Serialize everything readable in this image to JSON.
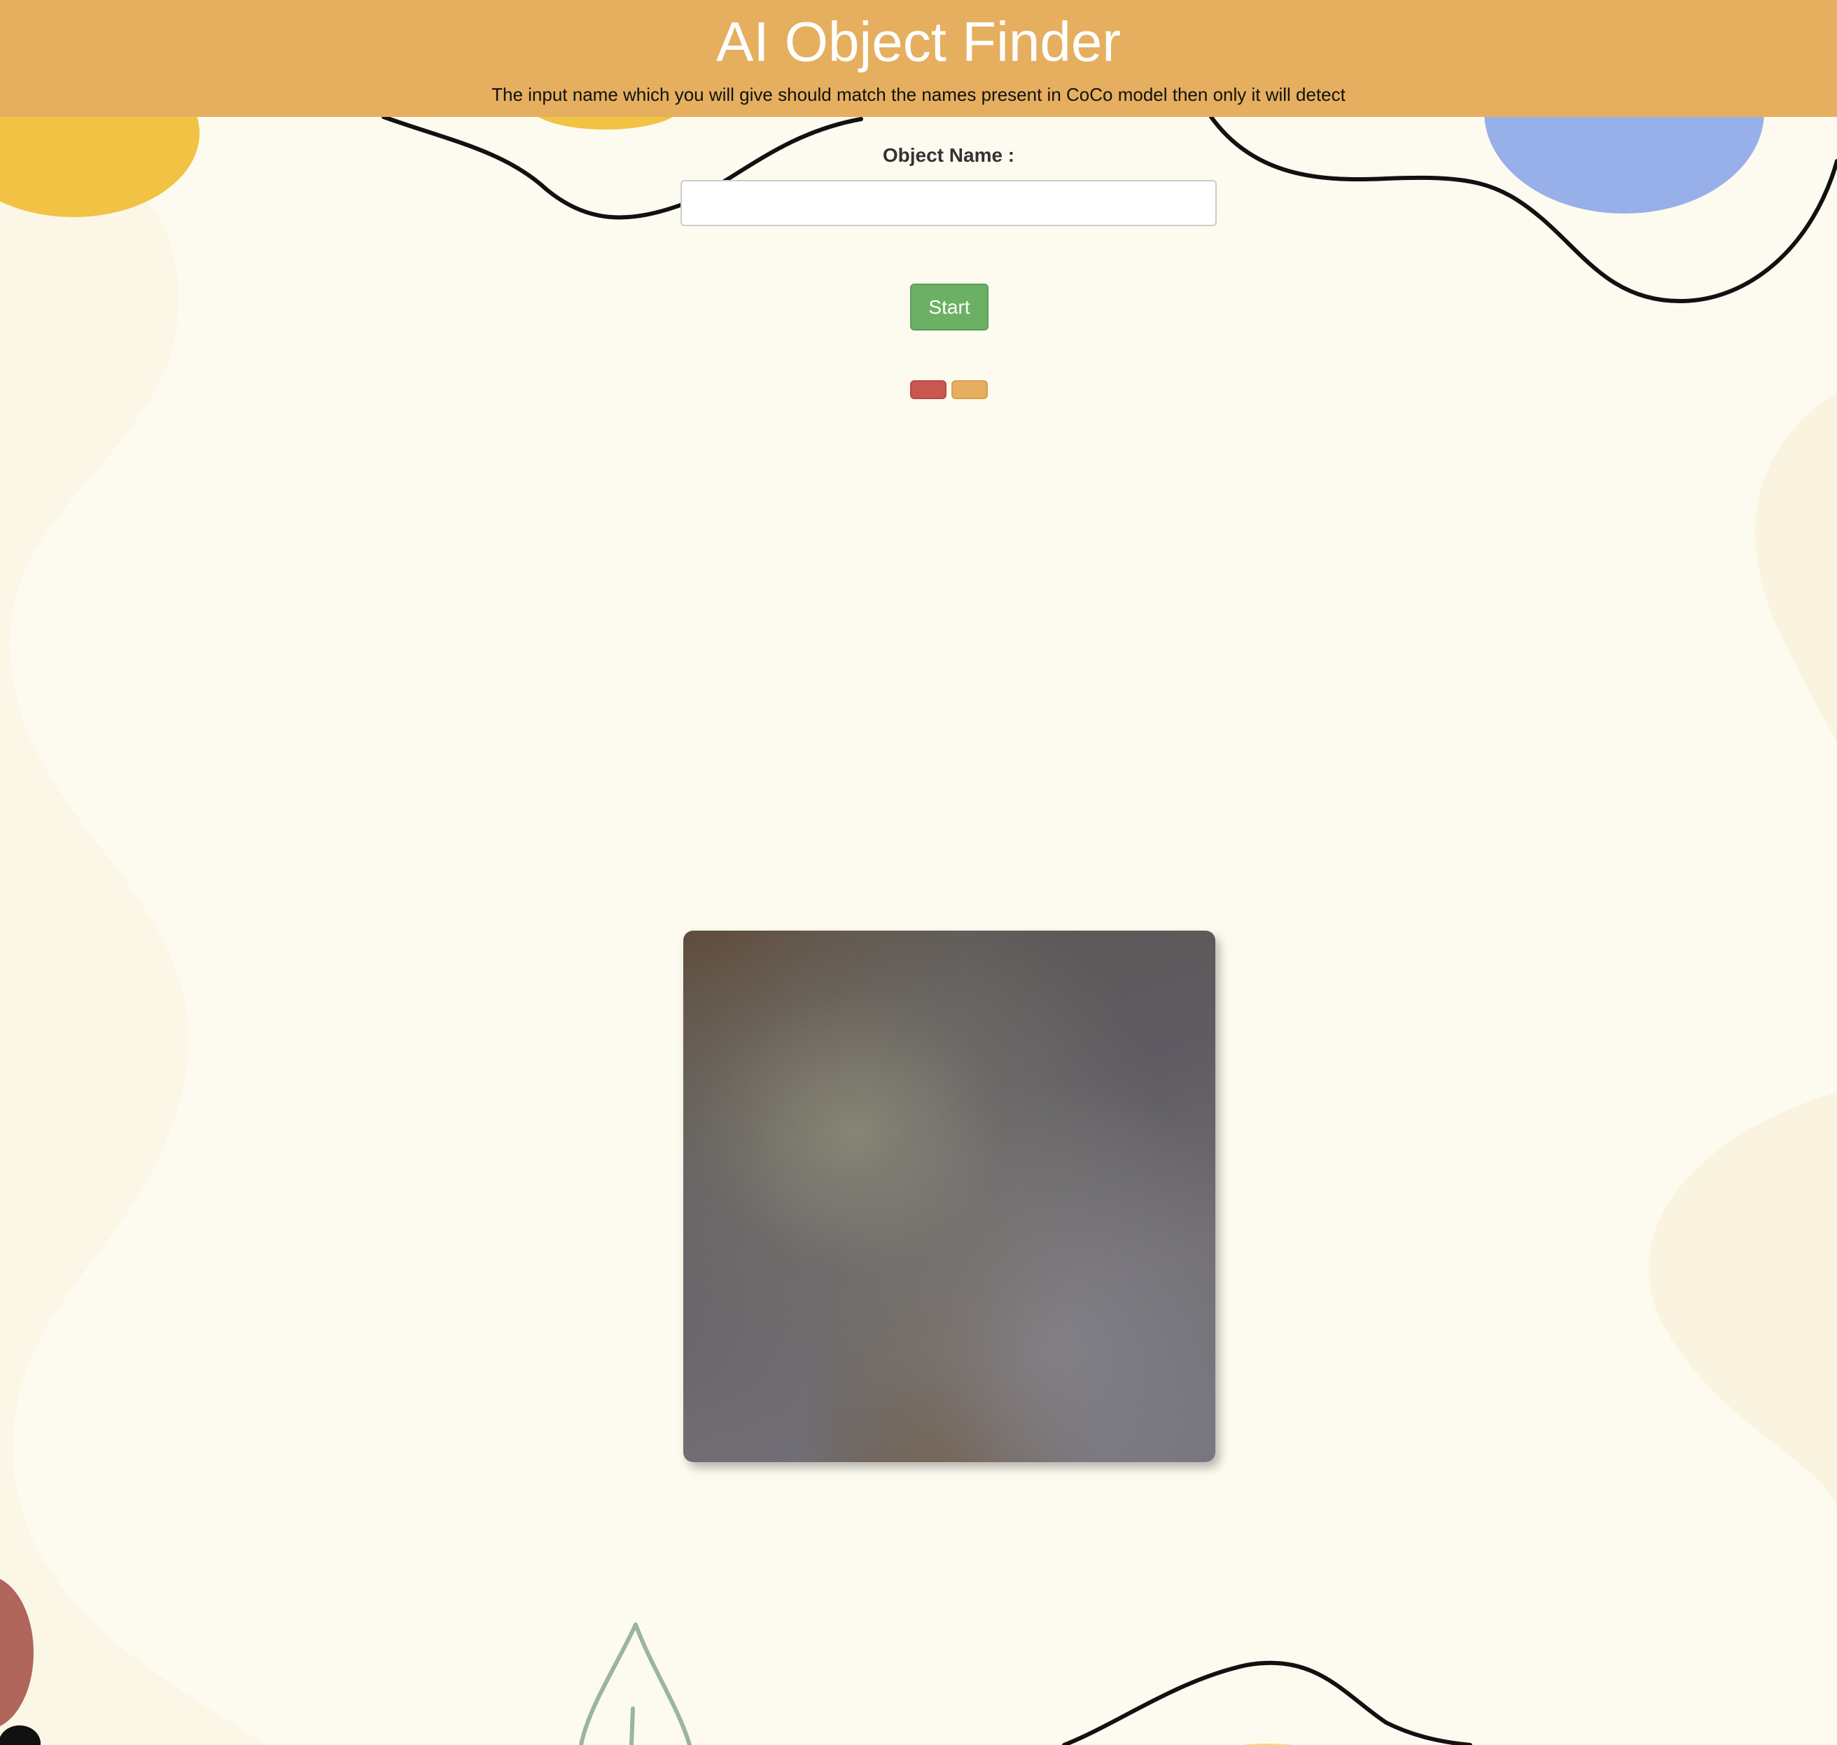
{
  "header": {
    "title": "AI Object Finder",
    "subtitle": "The input name which you will give should match the names present in CoCo model then only it will detect"
  },
  "form": {
    "object_name_label": "Object Name :",
    "object_name_value": "",
    "start_label": "Start"
  },
  "colors": {
    "header_bg": "#e5af5f",
    "page_bg": "#fdfbef",
    "start_button": "#6bb064",
    "red_button": "#c9574e",
    "amber_button": "#e5af5f"
  }
}
